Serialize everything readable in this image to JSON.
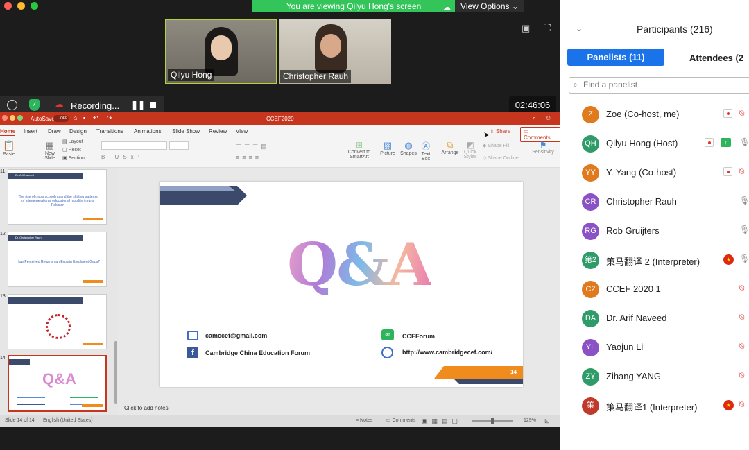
{
  "meeting": {
    "banner_text": "You are viewing Qilyu Hong's screen",
    "view_options_label": "View Options",
    "recording_label": "Recording...",
    "timer": "02:46:06",
    "video_tiles": [
      {
        "name": "Qilyu Hong"
      },
      {
        "name": "Christopher Rauh"
      }
    ]
  },
  "ppt": {
    "autosave_label": "AutoSave",
    "autosave_state": "OFF",
    "doc_title": "CCEF2020",
    "tabs": [
      "Home",
      "Insert",
      "Draw",
      "Design",
      "Transitions",
      "Animations",
      "Slide Show",
      "Review",
      "View"
    ],
    "share_label": "Share",
    "comments_label": "Comments",
    "ribbon_buttons": {
      "paste": "Paste",
      "layout": "Layout",
      "reset": "Reset",
      "new_slide": "New Slide",
      "section": "Section",
      "convert": "Convert to SmartArt",
      "picture": "Picture",
      "shapes": "Shapes",
      "textbox": "Text Box",
      "arrange": "Arrange",
      "quick_styles": "Quick Styles",
      "shape_fill": "Shape Fill",
      "shape_outline": "Shape Outline",
      "sensitivity": "Sensitivity"
    },
    "thumbnails": [
      {
        "num": "11",
        "author": "Dr. Arif Naveed",
        "text": "The rise of mass schooling and the shifting patterns of intergenerational educational mobility in rural Pakistan"
      },
      {
        "num": "12",
        "author": "Dr. Christopher Rauh",
        "text": "How Perceived Returns can Explain Enrolment Gaps?"
      },
      {
        "num": "13",
        "author": "",
        "text": ""
      },
      {
        "num": "14",
        "author": "",
        "text": "Q&A"
      }
    ],
    "slide": {
      "title": "Q&A",
      "email": "camccef@gmail.com",
      "facebook": "Cambridge China Education Forum",
      "wechat": "CCEForum",
      "website": "http://www.cambridgecef.com/",
      "page_number": "14"
    },
    "notes_placeholder": "Click to add notes",
    "status": {
      "slide_indicator": "Slide 14 of 14",
      "language": "English (United States)",
      "notes_label": "Notes",
      "comments_label": "Comments",
      "zoom": "129%"
    }
  },
  "participants": {
    "header": "Participants (216)",
    "tab_panelists": "Panelists (11)",
    "tab_attendees": "Attendees (2",
    "search_placeholder": "Find a panelist",
    "colors": {
      "accent": "#1a73e8",
      "orange": "#e07a1f",
      "purple": "#8a52c4",
      "green": "#2f9b69",
      "red": "#c03a2b"
    },
    "list": [
      {
        "initials": "Z",
        "name": "Zoe (Co-host, me)",
        "color": "#e07a1f",
        "rec": true,
        "mic": "off"
      },
      {
        "initials": "QH",
        "name": "Qilyu Hong (Host)",
        "color": "#2f9b69",
        "rec": true,
        "share": true,
        "mic": "on"
      },
      {
        "initials": "YY",
        "name": "Y. Yang (Co-host)",
        "color": "#e07a1f",
        "rec": true,
        "mic": "off"
      },
      {
        "initials": "CR",
        "name": "Christopher Rauh",
        "color": "#8a52c4",
        "mic": "on"
      },
      {
        "initials": "RG",
        "name": "Rob Gruijters",
        "color": "#8a52c4",
        "mic": "on"
      },
      {
        "initials": "第2",
        "name": "策马翻译 2 (Interpreter)",
        "color": "#2f9b69",
        "flag": true,
        "mic": "on"
      },
      {
        "initials": "C2",
        "name": "CCEF 2020 1",
        "color": "#e07a1f",
        "mic": "off"
      },
      {
        "initials": "DA",
        "name": "Dr. Arif Naveed",
        "color": "#2f9b69",
        "mic": "off"
      },
      {
        "initials": "YL",
        "name": "Yaojun Li",
        "color": "#8a52c4",
        "mic": "off"
      },
      {
        "initials": "ZY",
        "name": "Zihang YANG",
        "color": "#2f9b69",
        "mic": "off"
      },
      {
        "initials": "策",
        "name": "策马翻译1 (Interpreter)",
        "color": "#c03a2b",
        "flag": true,
        "mic": "off"
      }
    ]
  }
}
